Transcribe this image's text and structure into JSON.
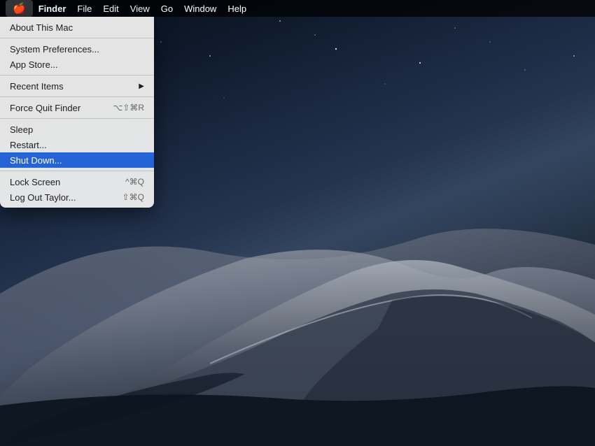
{
  "desktop": {
    "bg_description": "macOS Mojave desert dunes at dusk"
  },
  "menubar": {
    "items": [
      {
        "id": "apple",
        "label": "🍎",
        "active": true
      },
      {
        "id": "finder",
        "label": "Finder",
        "bold": true
      },
      {
        "id": "file",
        "label": "File"
      },
      {
        "id": "edit",
        "label": "Edit"
      },
      {
        "id": "view",
        "label": "View"
      },
      {
        "id": "go",
        "label": "Go"
      },
      {
        "id": "window",
        "label": "Window"
      },
      {
        "id": "help",
        "label": "Help"
      }
    ]
  },
  "apple_menu": {
    "sections": [
      {
        "items": [
          {
            "id": "about",
            "label": "About This Mac",
            "shortcut": ""
          }
        ]
      },
      {
        "items": [
          {
            "id": "system-prefs",
            "label": "System Preferences...",
            "shortcut": ""
          },
          {
            "id": "app-store",
            "label": "App Store...",
            "shortcut": ""
          }
        ]
      },
      {
        "items": [
          {
            "id": "recent-items",
            "label": "Recent Items",
            "arrow": "▶",
            "shortcut": ""
          }
        ]
      },
      {
        "items": [
          {
            "id": "force-quit",
            "label": "Force Quit Finder",
            "shortcut": "⌥⇧⌘R"
          }
        ]
      },
      {
        "items": [
          {
            "id": "sleep",
            "label": "Sleep",
            "shortcut": ""
          },
          {
            "id": "restart",
            "label": "Restart...",
            "shortcut": ""
          },
          {
            "id": "shutdown",
            "label": "Shut Down...",
            "shortcut": "",
            "highlighted": true
          }
        ]
      },
      {
        "items": [
          {
            "id": "lock-screen",
            "label": "Lock Screen",
            "shortcut": "^⌘Q"
          },
          {
            "id": "logout",
            "label": "Log Out Taylor...",
            "shortcut": "⇧⌘Q"
          }
        ]
      }
    ]
  }
}
